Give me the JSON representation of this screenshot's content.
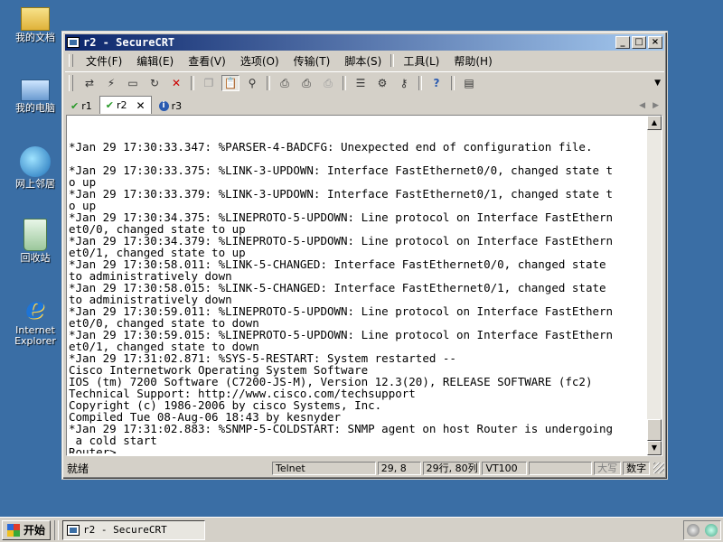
{
  "desktop": {
    "icons": [
      {
        "label": "我的文档"
      },
      {
        "label": "我的电脑"
      },
      {
        "label": "网上邻居"
      },
      {
        "label": "回收站"
      },
      {
        "label": "Internet Explorer"
      }
    ]
  },
  "window": {
    "title": "r2 - SecureCRT",
    "controls": {
      "minimize": "_",
      "maximize": "□",
      "close": "×"
    }
  },
  "menu": [
    "文件(F)",
    "编辑(E)",
    "查看(V)",
    "选项(O)",
    "传输(T)",
    "脚本(S)",
    "工具(L)",
    "帮助(H)"
  ],
  "toolbar": {
    "icons": [
      "connect-icon",
      "quick-connect-icon",
      "connect-tab-icon",
      "reconnect-icon",
      "disconnect-icon",
      "copy-icon",
      "paste-icon",
      "find-icon",
      "print-icon",
      "print-setup-icon",
      "print-screen-icon",
      "session-options-icon",
      "global-options-icon",
      "keymap-icon",
      "help-icon",
      "extra-icon"
    ]
  },
  "tabs": [
    {
      "label": "r1",
      "status": "connected",
      "active": false
    },
    {
      "label": "r2",
      "status": "connected",
      "active": true
    },
    {
      "label": "r3",
      "status": "info",
      "active": false
    }
  ],
  "terminal": {
    "lines": [
      "",
      "",
      "*Jan 29 17:30:33.347: %PARSER-4-BADCFG: Unexpected end of configuration file.",
      "",
      "*Jan 29 17:30:33.375: %LINK-3-UPDOWN: Interface FastEthernet0/0, changed state t",
      "o up",
      "*Jan 29 17:30:33.379: %LINK-3-UPDOWN: Interface FastEthernet0/1, changed state t",
      "o up",
      "*Jan 29 17:30:34.375: %LINEPROTO-5-UPDOWN: Line protocol on Interface FastEthern",
      "et0/0, changed state to up",
      "*Jan 29 17:30:34.379: %LINEPROTO-5-UPDOWN: Line protocol on Interface FastEthern",
      "et0/1, changed state to up",
      "*Jan 29 17:30:58.011: %LINK-5-CHANGED: Interface FastEthernet0/0, changed state",
      "to administratively down",
      "*Jan 29 17:30:58.015: %LINK-5-CHANGED: Interface FastEthernet0/1, changed state",
      "to administratively down",
      "*Jan 29 17:30:59.011: %LINEPROTO-5-UPDOWN: Line protocol on Interface FastEthern",
      "et0/0, changed state to down",
      "*Jan 29 17:30:59.015: %LINEPROTO-5-UPDOWN: Line protocol on Interface FastEthern",
      "et0/1, changed state to down",
      "*Jan 29 17:31:02.871: %SYS-5-RESTART: System restarted --",
      "Cisco Internetwork Operating System Software",
      "IOS (tm) 7200 Software (C7200-JS-M), Version 12.3(20), RELEASE SOFTWARE (fc2)",
      "Technical Support: http://www.cisco.com/techsupport",
      "Copyright (c) 1986-2006 by cisco Systems, Inc.",
      "Compiled Tue 08-Aug-06 18:43 by kesnyder",
      "*Jan 29 17:31:02.883: %SNMP-5-COLDSTART: SNMP agent on host Router is undergoing",
      " a cold start",
      "Router>"
    ]
  },
  "statusbar": {
    "ready": "就绪",
    "protocol": "Telnet",
    "cursor": "29, 8",
    "size": "29行, 80列",
    "emulation": "VT100",
    "blank": "",
    "caps": "大写",
    "num": "数字"
  },
  "taskbar": {
    "start": "开始",
    "task": "r2 - SecureCRT"
  }
}
